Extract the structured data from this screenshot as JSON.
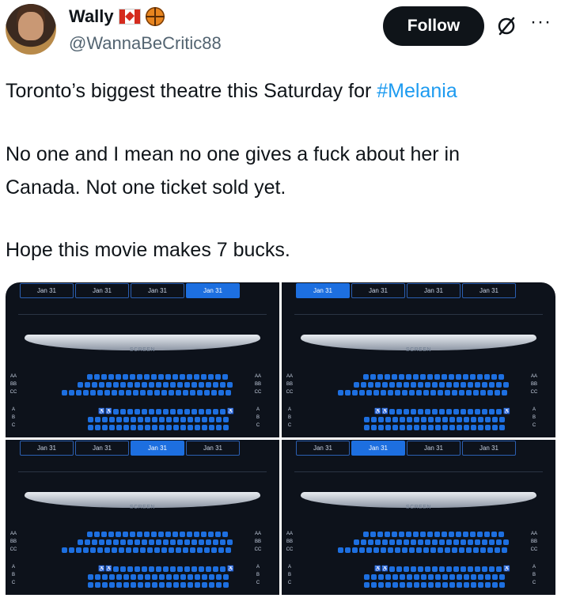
{
  "author": {
    "name": "Wally",
    "handle": "@WannaBeCritic88",
    "badges": [
      "canada-flag-icon",
      "basketball-icon"
    ]
  },
  "actions": {
    "follow_label": "Follow",
    "more_label": "···"
  },
  "tweet": {
    "line1_text": "Toronto’s biggest theatre this Saturday for ",
    "line1_hashtag": "#Melania",
    "line2": "No one and I mean no one gives a fuck about her in",
    "line3": "Canada. Not one ticket sold yet.",
    "line4": "Hope this movie makes 7 bucks."
  },
  "media": {
    "screen_label": "SCREEN",
    "row_labels_top": [
      "AA",
      "BB",
      "CC"
    ],
    "row_labels_bottom": [
      "A",
      "B",
      "C"
    ],
    "accessibility_symbol": "♿",
    "panels": [
      {
        "dates": [
          "Jan 31",
          "Jan 31",
          "Jan 31",
          "Jan 31"
        ],
        "selected": 3
      },
      {
        "dates": [
          "Jan 31",
          "Jan 31",
          "Jan 31",
          "Jan 31"
        ],
        "selected": 0
      },
      {
        "dates": [
          "Jan 31",
          "Jan 31",
          "Jan 31",
          "Jan 31"
        ],
        "selected": 2
      },
      {
        "dates": [
          "Jan 31",
          "Jan 31",
          "Jan 31",
          "Jan 31"
        ],
        "selected": 1
      }
    ]
  },
  "colors": {
    "hashtag": "#1d9bf0",
    "seat_available": "#1d6fe0",
    "panel_bg": "#0d121b"
  }
}
